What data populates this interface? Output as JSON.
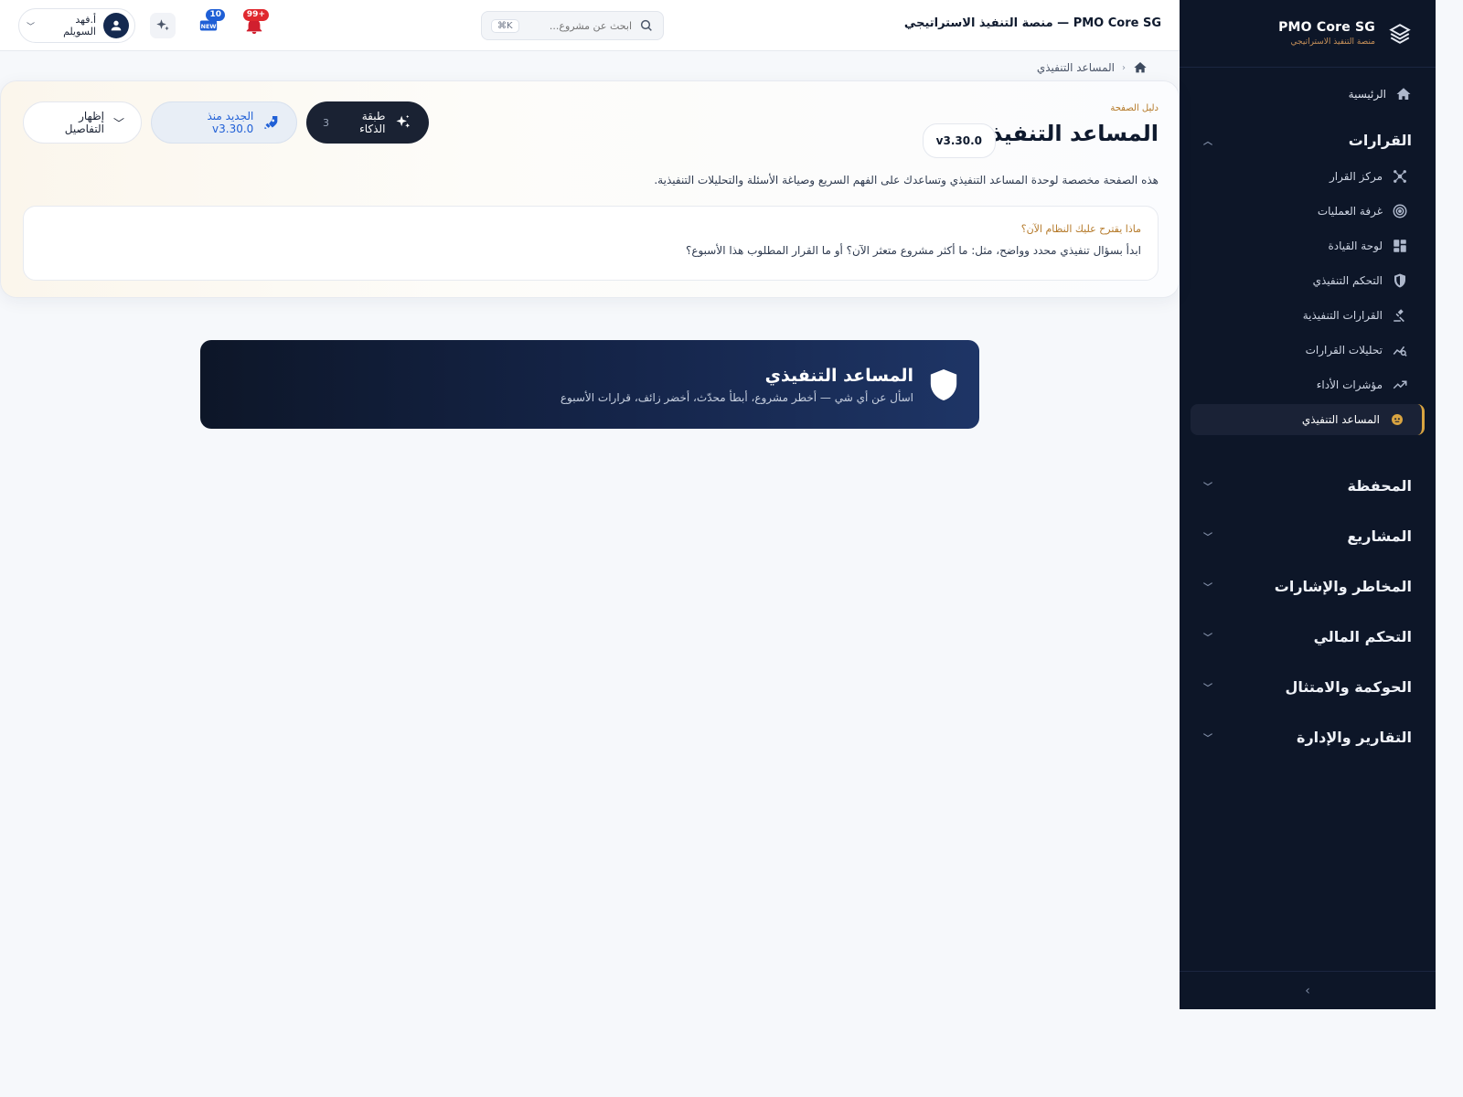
{
  "sidebar": {
    "brand_title": "PMO Core SG",
    "brand_subtitle": "منصة التنفيذ الاستراتيجي",
    "home_label": "الرئيسية",
    "decisions_section": "القرارات",
    "items": [
      {
        "label": "مركز القرار",
        "icon": "hub-icon"
      },
      {
        "label": "غرفة العمليات",
        "icon": "target-icon"
      },
      {
        "label": "لوحة القيادة",
        "icon": "dashboard-icon"
      },
      {
        "label": "التحكم التنفيذي",
        "icon": "shield-icon"
      },
      {
        "label": "القرارات التنفيذية",
        "icon": "gavel-icon"
      },
      {
        "label": "تحليلات القرارات",
        "icon": "analytics-icon"
      },
      {
        "label": "مؤشرات الأداء",
        "icon": "trend-icon"
      },
      {
        "label": "المساعد التنفيذي",
        "icon": "bot-icon",
        "active": true
      }
    ],
    "collapsed_sections": [
      "المحفظة",
      "المشاريع",
      "المخاطر والإشارات",
      "التحكم المالي",
      "الحوكمة والامتثال",
      "التقارير والإدارة"
    ]
  },
  "topbar": {
    "app_title": "PMO Core SG — منصة التنفيذ الاستراتيجي",
    "search_placeholder": "ابحث عن مشروع...",
    "search_shortcut": "⌘K",
    "notifications_badge": "+99",
    "news_badge": "10",
    "user_name": "أ.فهد السويلم"
  },
  "breadcrumb": {
    "current": "المساعد التنفيذي"
  },
  "guide": {
    "eyebrow": "دليل الصفحة",
    "title": "المساعد التنفيذي",
    "version": "v3.30.0",
    "description": "هذه الصفحة مخصصة لوحدة المساعد التنفيذي وتساعدك على الفهم السريع وصياغة الأسئلة والتحليلات التنفيذية.",
    "suggest_label": "ماذا يقترح عليك النظام الآن؟",
    "suggest_text": "ابدأ بسؤال تنفيذي محدد وواضح، مثل: ما أكثر مشروع متعثر الآن؟ أو ما القرار المطلوب هذا الأسبوع؟",
    "ai_layer_label": "طبقة الذكاء",
    "ai_layer_count": "3",
    "whats_new_label": "الجديد منذ v3.30.0",
    "details_label": "إظهار التفاصيل"
  },
  "hero": {
    "title": "المساعد التنفيذي",
    "subtitle": "اسأل عن أي شي — أخطر مشروع، أبطأ محدّث، أخضر زائف، قرارات الأسبوع"
  }
}
